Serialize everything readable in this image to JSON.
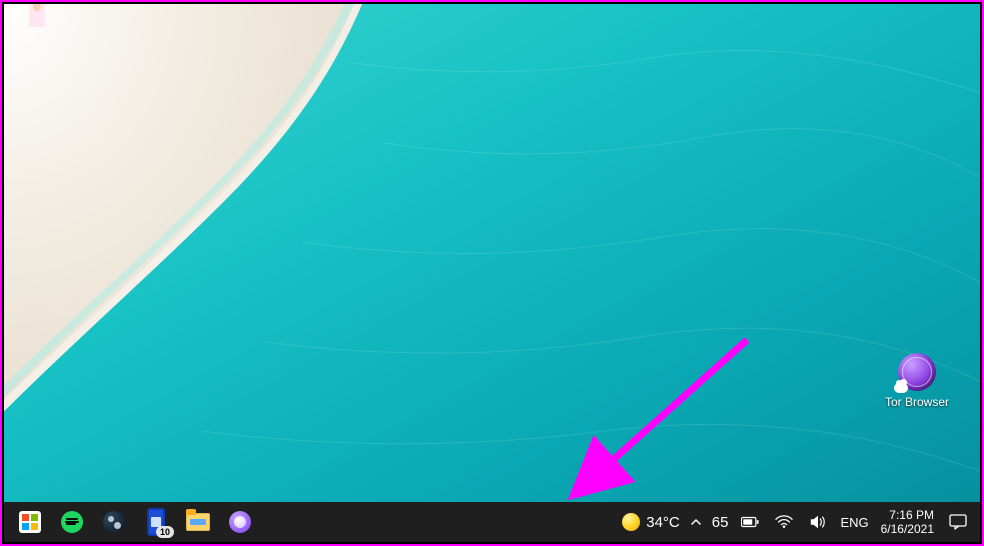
{
  "desktop": {
    "icons": [
      {
        "name": "tor-browser-shortcut",
        "label": "Tor Browser"
      }
    ]
  },
  "annotation": {
    "color": "#ff00ff"
  },
  "taskbar": {
    "pinned": [
      {
        "name": "microsoft-store",
        "icon": "store-icon"
      },
      {
        "name": "spotify",
        "icon": "spotify-icon"
      },
      {
        "name": "steam",
        "icon": "steam-icon"
      },
      {
        "name": "your-phone",
        "icon": "phone-icon",
        "badge": "10"
      },
      {
        "name": "file-explorer",
        "icon": "file-explorer-icon"
      },
      {
        "name": "purple-app",
        "icon": "purple-circle-icon"
      }
    ],
    "weather": {
      "icon": "sunny-icon",
      "temperature": "34°C"
    },
    "tray": {
      "overflow_icon": "chevron-up-icon",
      "count": "65",
      "battery_icon": "battery-icon",
      "wifi_icon": "wifi-icon",
      "volume_icon": "speaker-icon",
      "ime": "ENG",
      "time": "7:16 PM",
      "date": "6/16/2021",
      "notifications_icon": "notifications-icon"
    }
  }
}
